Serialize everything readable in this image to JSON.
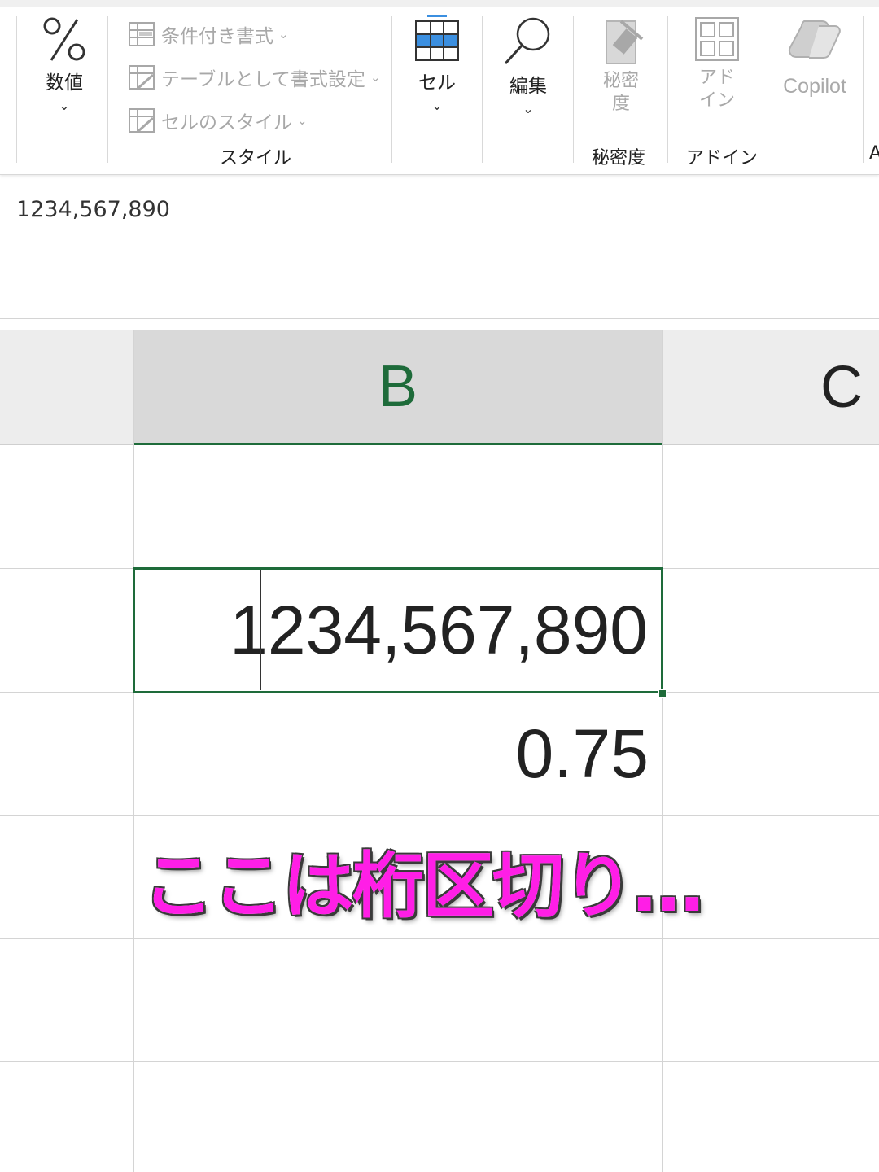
{
  "ribbon": {
    "number_group": {
      "label": "数値"
    },
    "styles": {
      "conditional_formatting": "条件付き書式",
      "format_as_table": "テーブルとして書式設定",
      "cell_styles": "セルのスタイル",
      "group_label": "スタイル"
    },
    "cells": {
      "label": "セル"
    },
    "editing": {
      "label": "編集"
    },
    "sensitivity": {
      "button_label_line1": "秘密",
      "button_label_line2": "度",
      "group_label": "秘密度"
    },
    "addins": {
      "button_label_line1": "アド",
      "button_label_line2": "イン",
      "group_label": "アドイン"
    },
    "copilot": {
      "label": "Copilot"
    },
    "cut_off_label": "A"
  },
  "formula_bar": {
    "content": "1234,567,890"
  },
  "sheet": {
    "columns": [
      "B",
      "C"
    ],
    "cells": {
      "active_value": "1234,567,890",
      "next_value": "0.75"
    }
  },
  "caption": {
    "text": "ここは桁区切り…"
  },
  "colors": {
    "excel_green": "#1e6b3a",
    "caption_magenta": "#ff1ee6",
    "cell_button_blue": "#3b8fe0"
  },
  "icons": [
    "percent-icon",
    "conditional-format-icon",
    "table-format-icon",
    "cell-style-icon",
    "cells-icon",
    "search-icon",
    "sensitivity-icon",
    "addins-icon",
    "copilot-icon",
    "chevron-down-icon"
  ]
}
